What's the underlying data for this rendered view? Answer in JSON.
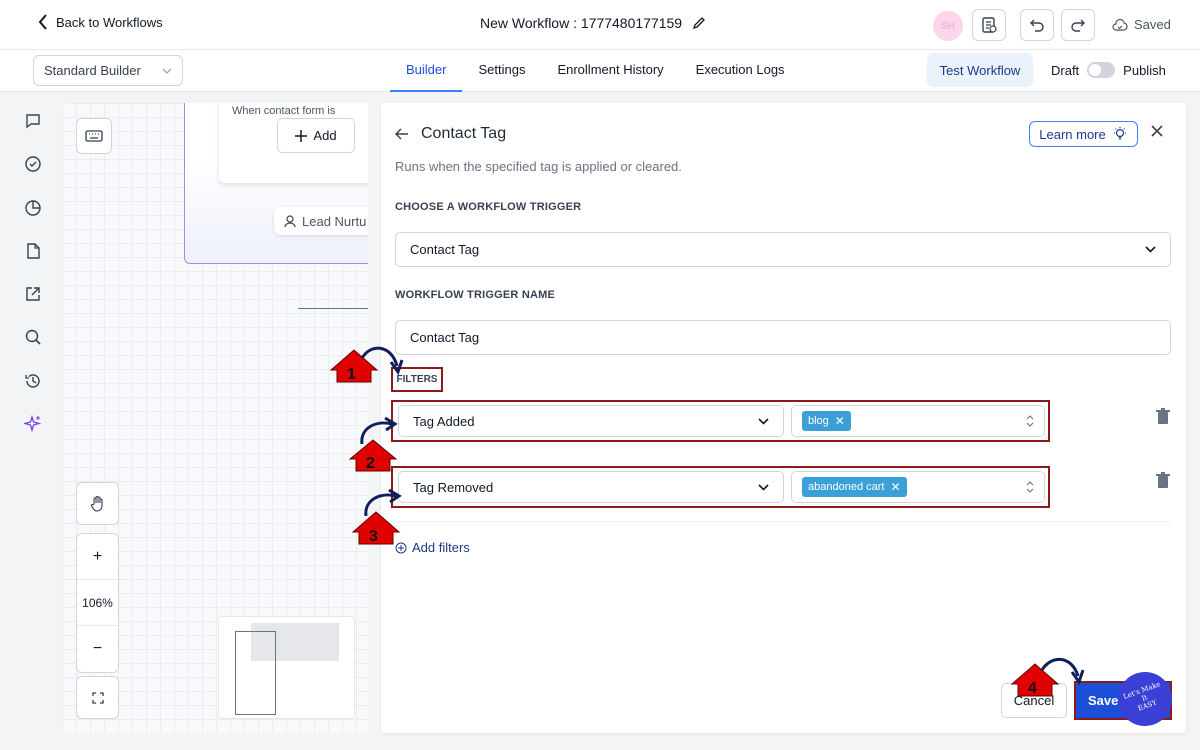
{
  "topbar": {
    "back_label": "Back to Workflows",
    "workflow_title": "New Workflow : 1777480177159",
    "avatar_initials": "SH",
    "saved_label": "Saved"
  },
  "subbar": {
    "builder_select_value": "Standard Builder",
    "tabs": [
      {
        "label": "Builder",
        "active": true
      },
      {
        "label": "Settings",
        "active": false
      },
      {
        "label": "Enrollment History",
        "active": false
      },
      {
        "label": "Execution Logs",
        "active": false
      }
    ],
    "test_workflow_label": "Test Workflow",
    "draft_label": "Draft",
    "publish_label": "Publish"
  },
  "rail": {
    "icons": [
      "chat-icon",
      "check-circle-icon",
      "pie-chart-icon",
      "document-icon",
      "external-link-icon",
      "search-icon",
      "history-icon",
      "sparkle-icon"
    ]
  },
  "canvas": {
    "node_caption": "When contact form is",
    "add_label": "Add",
    "lead_chip_label": "Lead Nurtu",
    "zoom_level": "106%",
    "zoom_in": "+",
    "zoom_out": "−"
  },
  "panel": {
    "title": "Contact Tag",
    "description": "Runs when the specified tag is applied or cleared.",
    "learn_more_label": "Learn more",
    "trigger_section_label": "CHOOSE A WORKFLOW TRIGGER",
    "trigger_value": "Contact Tag",
    "name_section_label": "WORKFLOW TRIGGER NAME",
    "name_value": "Contact Tag",
    "filters_label": "FILTERS",
    "filters": [
      {
        "type": "Tag Added",
        "tags": [
          "blog"
        ]
      },
      {
        "type": "Tag Removed",
        "tags": [
          "abandoned cart"
        ]
      }
    ],
    "add_filters_label": "Add filters",
    "cancel_label": "Cancel",
    "save_label": "Save"
  },
  "annotations": {
    "steps": [
      "1",
      "2",
      "3",
      "4"
    ],
    "watermark_text": "Let's Make\nIt\nEASY",
    "arrow_color": "#e00000",
    "highlight_color": "#8b1a1a"
  },
  "colors": {
    "accent": "#1d4ed8",
    "tag_bg": "#3b9fd8",
    "node_border": "#a78bda"
  }
}
